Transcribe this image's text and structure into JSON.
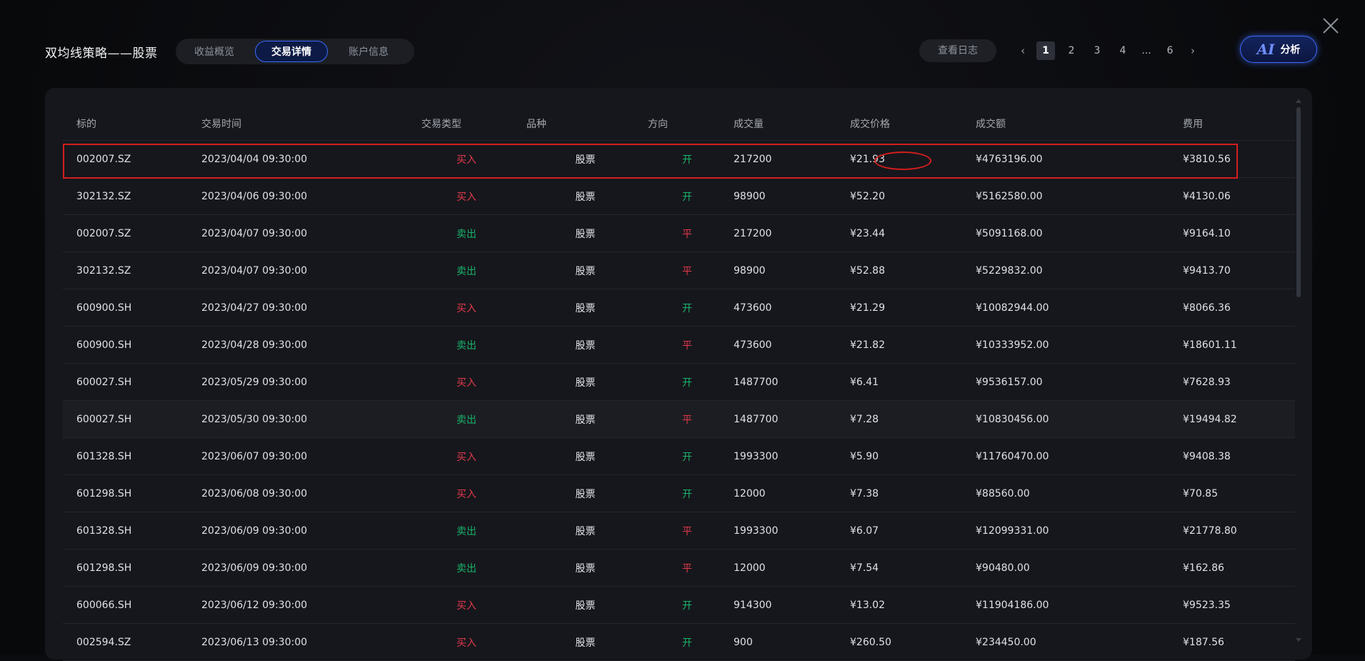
{
  "window": {
    "title": "双均线策略——股票"
  },
  "tabs": [
    {
      "label": "收益概览",
      "active": false
    },
    {
      "label": "交易详情",
      "active": true
    },
    {
      "label": "账户信息",
      "active": false
    }
  ],
  "toolbar": {
    "log_label": "查看日志",
    "ai_logo": "AI",
    "ai_label": "分析"
  },
  "pagination": {
    "prev_icon": "‹",
    "next_icon": "›",
    "pages": [
      "1",
      "2",
      "3",
      "4",
      "...",
      "6"
    ],
    "current": "1"
  },
  "icons": {
    "close": "close-icon",
    "prev": "chevron-left-icon",
    "next": "chevron-right-icon"
  },
  "colors": {
    "buy": "#e2394c",
    "sell": "#19b36b",
    "accent": "#3b6bff",
    "annotation": "#d21e1e"
  },
  "table": {
    "columns": [
      "标的",
      "交易时间",
      "交易类型",
      "品种",
      "方向",
      "成交量",
      "成交价格",
      "成交额",
      "费用"
    ],
    "rows": [
      {
        "symbol": "002007.SZ",
        "time": "2023/04/04 09:30:00",
        "type": "买入",
        "kind": "股票",
        "dir": "开",
        "vol": "217200",
        "price": "¥21.93",
        "amount": "¥4763196.00",
        "fee": "¥3810.56"
      },
      {
        "symbol": "302132.SZ",
        "time": "2023/04/06 09:30:00",
        "type": "买入",
        "kind": "股票",
        "dir": "开",
        "vol": "98900",
        "price": "¥52.20",
        "amount": "¥5162580.00",
        "fee": "¥4130.06"
      },
      {
        "symbol": "002007.SZ",
        "time": "2023/04/07 09:30:00",
        "type": "卖出",
        "kind": "股票",
        "dir": "平",
        "vol": "217200",
        "price": "¥23.44",
        "amount": "¥5091168.00",
        "fee": "¥9164.10"
      },
      {
        "symbol": "302132.SZ",
        "time": "2023/04/07 09:30:00",
        "type": "卖出",
        "kind": "股票",
        "dir": "平",
        "vol": "98900",
        "price": "¥52.88",
        "amount": "¥5229832.00",
        "fee": "¥9413.70"
      },
      {
        "symbol": "600900.SH",
        "time": "2023/04/27 09:30:00",
        "type": "买入",
        "kind": "股票",
        "dir": "开",
        "vol": "473600",
        "price": "¥21.29",
        "amount": "¥10082944.00",
        "fee": "¥8066.36"
      },
      {
        "symbol": "600900.SH",
        "time": "2023/04/28 09:30:00",
        "type": "卖出",
        "kind": "股票",
        "dir": "平",
        "vol": "473600",
        "price": "¥21.82",
        "amount": "¥10333952.00",
        "fee": "¥18601.11"
      },
      {
        "symbol": "600027.SH",
        "time": "2023/05/29 09:30:00",
        "type": "买入",
        "kind": "股票",
        "dir": "开",
        "vol": "1487700",
        "price": "¥6.41",
        "amount": "¥9536157.00",
        "fee": "¥7628.93"
      },
      {
        "symbol": "600027.SH",
        "time": "2023/05/30 09:30:00",
        "type": "卖出",
        "kind": "股票",
        "dir": "平",
        "vol": "1487700",
        "price": "¥7.28",
        "amount": "¥10830456.00",
        "fee": "¥19494.82"
      },
      {
        "symbol": "601328.SH",
        "time": "2023/06/07 09:30:00",
        "type": "买入",
        "kind": "股票",
        "dir": "开",
        "vol": "1993300",
        "price": "¥5.90",
        "amount": "¥11760470.00",
        "fee": "¥9408.38"
      },
      {
        "symbol": "601298.SH",
        "time": "2023/06/08 09:30:00",
        "type": "买入",
        "kind": "股票",
        "dir": "开",
        "vol": "12000",
        "price": "¥7.38",
        "amount": "¥88560.00",
        "fee": "¥70.85"
      },
      {
        "symbol": "601328.SH",
        "time": "2023/06/09 09:30:00",
        "type": "卖出",
        "kind": "股票",
        "dir": "平",
        "vol": "1993300",
        "price": "¥6.07",
        "amount": "¥12099331.00",
        "fee": "¥21778.80"
      },
      {
        "symbol": "601298.SH",
        "time": "2023/06/09 09:30:00",
        "type": "卖出",
        "kind": "股票",
        "dir": "平",
        "vol": "12000",
        "price": "¥7.54",
        "amount": "¥90480.00",
        "fee": "¥162.86"
      },
      {
        "symbol": "600066.SH",
        "time": "2023/06/12 09:30:00",
        "type": "买入",
        "kind": "股票",
        "dir": "开",
        "vol": "914300",
        "price": "¥13.02",
        "amount": "¥11904186.00",
        "fee": "¥9523.35"
      },
      {
        "symbol": "002594.SZ",
        "time": "2023/06/13 09:30:00",
        "type": "买入",
        "kind": "股票",
        "dir": "开",
        "vol": "900",
        "price": "¥260.50",
        "amount": "¥234450.00",
        "fee": "¥187.56"
      }
    ]
  }
}
